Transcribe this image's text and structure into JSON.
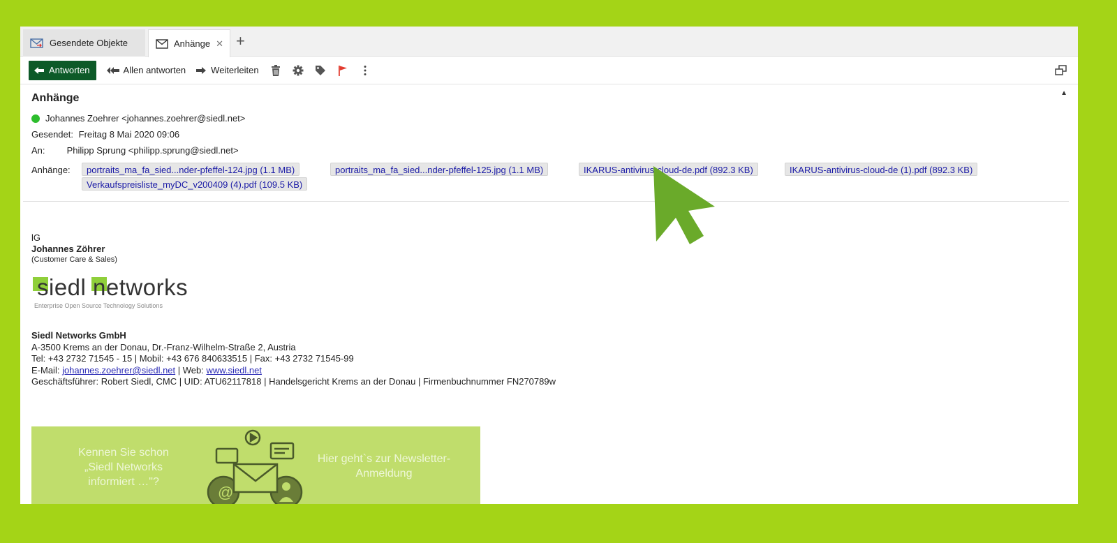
{
  "tabs": [
    {
      "label": "Gesendete Objekte",
      "active": false
    },
    {
      "label": "Anhänge",
      "active": true
    }
  ],
  "toolbar": {
    "reply": "Antworten",
    "reply_all": "Allen antworten",
    "forward": "Weiterleiten"
  },
  "message": {
    "subject": "Anhänge",
    "from": "Johannes Zoehrer <johannes.zoehrer@siedl.net>",
    "sent_label": "Gesendet:",
    "sent_value": "Freitag 8 Mai 2020 09:06",
    "to_label": "An:",
    "to_value": "Philipp Sprung <philipp.sprung@siedl.net>",
    "attachments_label": "Anhänge:",
    "attachments": [
      "portraits_ma_fa_sied...nder-pfeffel-124.jpg (1.1 MB)",
      "portraits_ma_fa_sied...nder-pfeffel-125.jpg (1.1 MB)",
      "IKARUS-antivirus-cloud-de.pdf (892.3 KB)",
      "IKARUS-antivirus-cloud-de (1).pdf (892.3 KB)",
      "Verkaufspreisliste_myDC_v200409 (4).pdf (109.5 KB)"
    ]
  },
  "body": {
    "greeting": "lG",
    "name": "Johannes Zöhrer",
    "role": "(Customer Care & Sales)",
    "logo_text": "siedl networks",
    "logo_sub": "Enterprise Open Source Technology Solutions",
    "company": "Siedl Networks GmbH",
    "address": "A-3500 Krems an der Donau, Dr.-Franz-Wilhelm-Straße 2, Austria",
    "phone": "Tel: +43 2732 71545 - 15 | Mobil: +43 676 840633515 | Fax: +43 2732 71545-99",
    "email_prefix": "E-Mail: ",
    "email": "johannes.zoehrer@siedl.net",
    "web_prefix": " | Web: ",
    "web": "www.siedl.net",
    "legal": "Geschäftsführer: Robert Siedl, CMC | UID: ATU62117818 | Handelsgericht Krems an der Donau | Firmenbuchnummer FN270789w",
    "banner_left": "Kennen Sie schon „Siedl Networks informiert …\"?",
    "banner_right": "Hier geht`s zur Newsletter-Anmeldung"
  },
  "colors": {
    "background": "#a4d417",
    "reply_button": "#0d5a28",
    "online_dot": "#2dbd2d",
    "banner": "#c0dd6c",
    "cursor": "#6aaa2a"
  }
}
